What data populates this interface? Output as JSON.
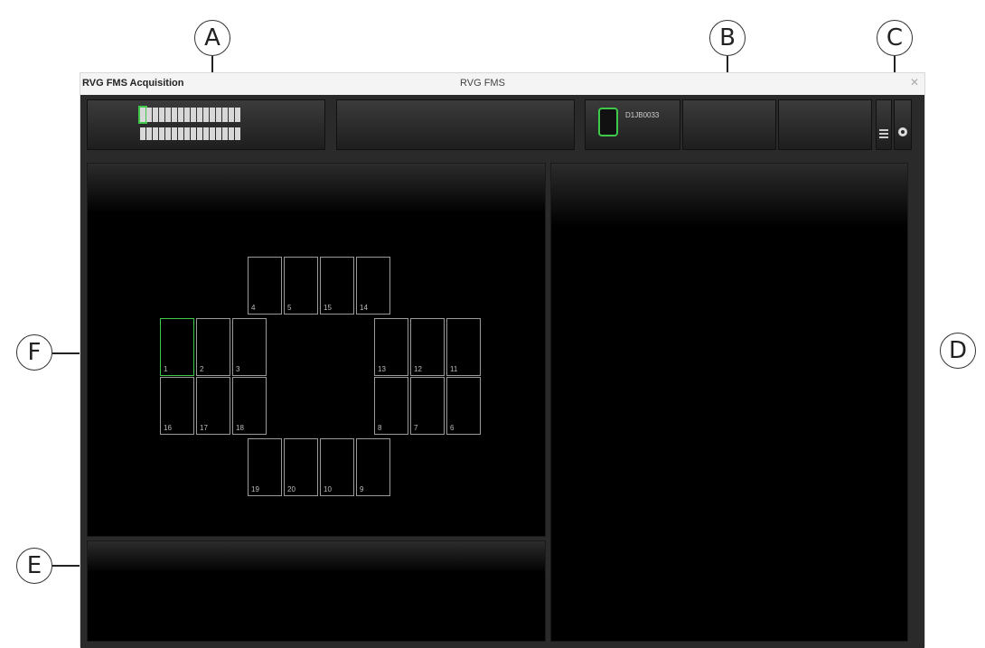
{
  "window": {
    "title": "RVG FMS Acquisition",
    "center_title": "RVG FMS",
    "close_glyph": "✕"
  },
  "callouts": {
    "a": "A",
    "b": "B",
    "c": "C",
    "d": "D",
    "e": "E",
    "f": "F"
  },
  "toolbar": {
    "sensor_label": "D1JB0033",
    "icons": [
      "teeth-chart-icon",
      "sensor-icon",
      "menu-icon",
      "gear-icon"
    ]
  },
  "fms_grid": {
    "cells": [
      {
        "label": "4",
        "active": false
      },
      {
        "label": "5",
        "active": false
      },
      {
        "label": "15",
        "active": false
      },
      {
        "label": "14",
        "active": false
      },
      {
        "label": "1",
        "active": true
      },
      {
        "label": "2",
        "active": false
      },
      {
        "label": "3",
        "active": false
      },
      {
        "label": "13",
        "active": false
      },
      {
        "label": "12",
        "active": false
      },
      {
        "label": "11",
        "active": false
      },
      {
        "label": "16",
        "active": false
      },
      {
        "label": "17",
        "active": false
      },
      {
        "label": "18",
        "active": false
      },
      {
        "label": "8",
        "active": false
      },
      {
        "label": "7",
        "active": false
      },
      {
        "label": "6",
        "active": false
      },
      {
        "label": "19",
        "active": false
      },
      {
        "label": "20",
        "active": false
      },
      {
        "label": "10",
        "active": false
      },
      {
        "label": "9",
        "active": false
      }
    ]
  },
  "colors": {
    "accent_green": "#3ec94a",
    "panel_black": "#000000",
    "frame_gray": "#2a2a2a"
  }
}
